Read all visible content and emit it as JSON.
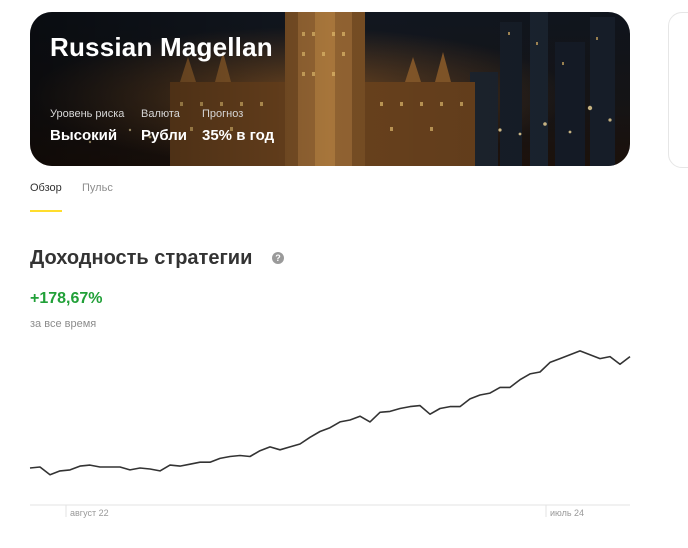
{
  "hero": {
    "title": "Russian Magellan",
    "params": [
      {
        "label": "Уровень риска",
        "value": "Высокий"
      },
      {
        "label": "Валюта",
        "value": "Рубли"
      },
      {
        "label": "Прогноз",
        "value": "35% в год"
      }
    ]
  },
  "tabs": [
    {
      "label": "Обзор",
      "active": true
    },
    {
      "label": "Пульс",
      "active": false
    }
  ],
  "section": {
    "title": "Доходность стратегии",
    "help_icon": "question-icon",
    "yield_value": "+178,67%",
    "yield_caption": "за все время"
  },
  "colors": {
    "accent": "#ffdd2d",
    "positive": "#21a038",
    "line": "#333333"
  },
  "chart_data": {
    "type": "line",
    "x_tick_labels": [
      "август 22",
      "июль 24"
    ],
    "series": [
      {
        "values": [
          0,
          0.5,
          -3.5,
          -1.5,
          -1,
          1,
          1.5,
          0.5,
          0.5,
          0.5,
          -1,
          0,
          -0.5,
          -1.5,
          1.5,
          1,
          2,
          3,
          3,
          5,
          6,
          6.5,
          6,
          9,
          11,
          9.5,
          11,
          12.5,
          16,
          19,
          21,
          24,
          25,
          27,
          24,
          29,
          29.5,
          31,
          32,
          32.5,
          28,
          31,
          32,
          32,
          36,
          38,
          39,
          42,
          42,
          46,
          49,
          50,
          55,
          57,
          59,
          61,
          59,
          57,
          58,
          54,
          58
        ]
      }
    ]
  }
}
